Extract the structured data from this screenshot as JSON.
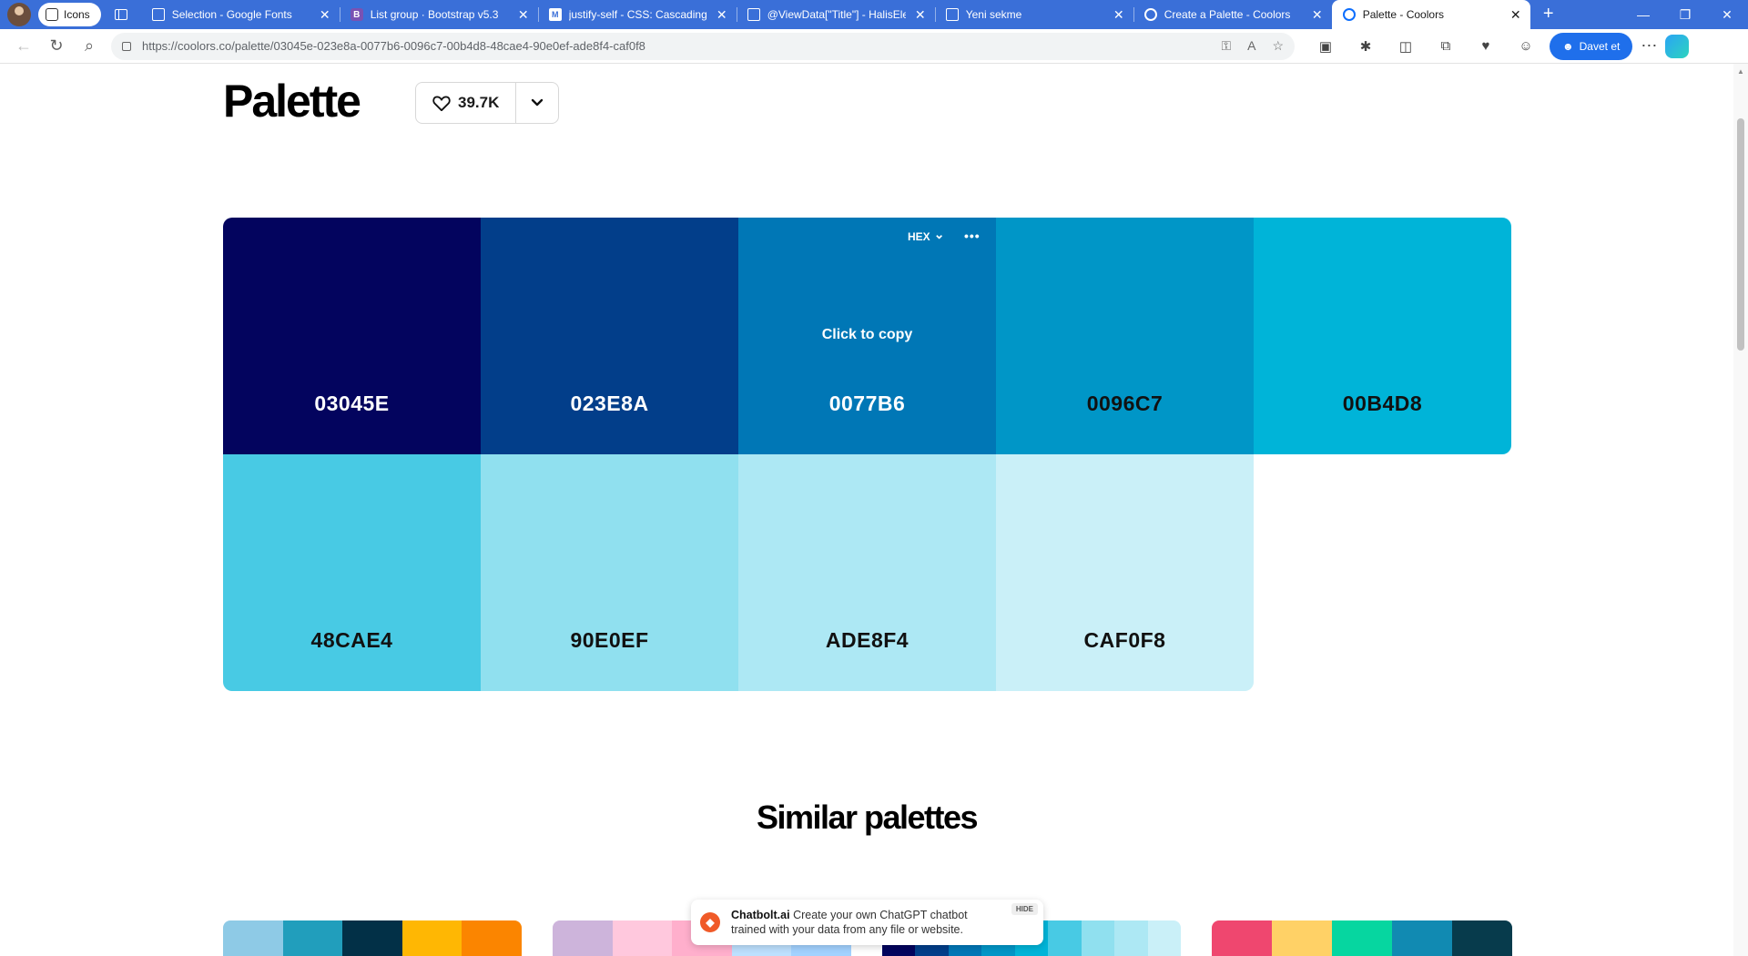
{
  "browser": {
    "workspace_label": "Icons",
    "tabs": [
      {
        "title": "Selection - Google Fonts",
        "favicon": "doc-icon",
        "active": false
      },
      {
        "title": "List group · Bootstrap v5.3",
        "favicon": "bootstrap-icon",
        "active": false
      },
      {
        "title": "justify-self - CSS: Cascading S",
        "favicon": "mdn-icon",
        "active": false
      },
      {
        "title": "@ViewData[\"Title\"] - HalisEle",
        "favicon": "doc-icon",
        "active": false
      },
      {
        "title": "Yeni sekme",
        "favicon": "newtab-icon",
        "active": false
      },
      {
        "title": "Create a Palette - Coolors",
        "favicon": "coolors-icon",
        "active": false
      },
      {
        "title": "Palette - Coolors",
        "favicon": "coolors-icon",
        "active": true
      }
    ],
    "url": "https://coolors.co/palette/03045e-023e8a-0077b6-0096c7-00b4d8-48cae4-90e0ef-ade8f4-caf0f8",
    "invite_label": "Davet et"
  },
  "page": {
    "title": "Palette",
    "likes": "39.7K",
    "palette": {
      "format_label": "HEX",
      "copy_hint": "Click to copy",
      "hovered_index": 2,
      "colors": [
        {
          "hex": "03045E",
          "color": "#03045e",
          "text_color": "#ffffff"
        },
        {
          "hex": "023E8A",
          "color": "#023e8a",
          "text_color": "#ffffff"
        },
        {
          "hex": "0077B6",
          "color": "#0077b6",
          "text_color": "#ffffff"
        },
        {
          "hex": "0096C7",
          "color": "#0096c7",
          "text_color": "#111111"
        },
        {
          "hex": "00B4D8",
          "color": "#00b4d8",
          "text_color": "#111111"
        },
        {
          "hex": "48CAE4",
          "color": "#48cae4",
          "text_color": "#111111"
        },
        {
          "hex": "90E0EF",
          "color": "#90e0ef",
          "text_color": "#111111"
        },
        {
          "hex": "ADE8F4",
          "color": "#ade8f4",
          "text_color": "#111111"
        },
        {
          "hex": "CAF0F8",
          "color": "#caf0f8",
          "text_color": "#111111"
        }
      ]
    },
    "similar_title": "Similar palettes",
    "similar_palettes": [
      [
        "#8ecae6",
        "#219ebc",
        "#023047",
        "#ffb703",
        "#fb8500"
      ],
      [
        "#cdb4db",
        "#ffc8dd",
        "#ffafcc",
        "#bde0fe",
        "#a2d2ff"
      ],
      [
        "#03045e",
        "#023e8a",
        "#0077b6",
        "#0096c7",
        "#00b4d8",
        "#48cae4",
        "#90e0ef",
        "#ade8f4",
        "#caf0f8"
      ],
      [
        "#ef476f",
        "#ffd166",
        "#06d6a0",
        "#118ab2",
        "#073b4c"
      ]
    ],
    "ad": {
      "brand": "Chatbolt.ai",
      "text": "Create your own ChatGPT chatbot trained with your data from any file or website.",
      "hide_label": "HIDE"
    }
  }
}
